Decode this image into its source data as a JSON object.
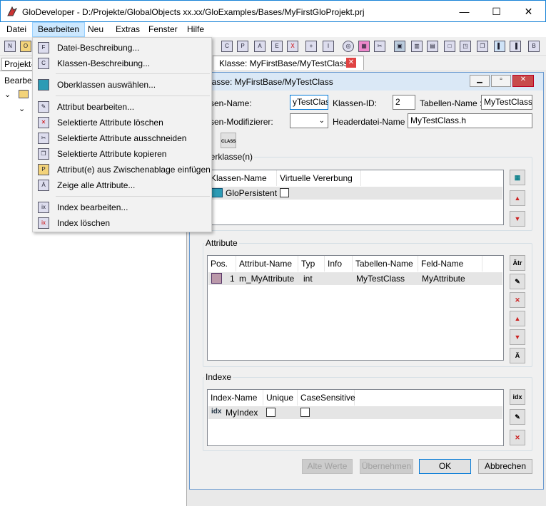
{
  "window": {
    "title": "GloDeveloper - D:/Projekte/GlobalObjects xx.xx/GloExamples/Bases/MyFirstGloProjekt.prj",
    "minimize": "—",
    "maximize": "☐",
    "close": "✕"
  },
  "menubar": [
    "Datei",
    "Bearbeiten",
    "Neu",
    "Extras",
    "Fenster",
    "Hilfe"
  ],
  "left": {
    "tab": "Projekt-",
    "tree_label": "Bearbei"
  },
  "doc_tab": {
    "label": "Klasse: MyFirstBase/MyTestClass",
    "close": "✕"
  },
  "dropdown": [
    {
      "label": "Datei-Beschreibung...",
      "icon": "file-icon"
    },
    {
      "label": "Klassen-Beschreibung...",
      "icon": "class-icon"
    },
    {
      "label": "Oberklassen auswählen...",
      "icon": "superclass-icon"
    },
    {
      "label": "Attribut bearbeiten...",
      "icon": "edit-attribute-icon"
    },
    {
      "label": "Selektierte Attribute löschen",
      "icon": "delete-attribute-icon"
    },
    {
      "label": "Selektierte Attribute ausschneiden",
      "icon": "cut-icon"
    },
    {
      "label": "Selektierte Attribute kopieren",
      "icon": "copy-icon"
    },
    {
      "label": "Attribut(e) aus Zwischenablage einfügen",
      "icon": "paste-icon"
    },
    {
      "label": "Zeige alle Attribute...",
      "icon": "show-attributes-icon"
    },
    {
      "label": "Index bearbeiten...",
      "icon": "edit-index-icon"
    },
    {
      "label": "Index löschen",
      "icon": "delete-index-icon"
    }
  ],
  "child": {
    "title": "Klasse: MyFirstBase/MyTestClass",
    "klassen_name_label": "ssen-Name:",
    "klassen_name_value": "yTestClass",
    "klassen_id_label": "Klassen-ID:",
    "klassen_id_value": "2",
    "tabellen_name_label": "Tabellen-Name :",
    "tabellen_name_value": "MyTestClass",
    "modifier_label": "ssen-Modifizierer:",
    "headerdatei_label": "Headerdatei-Name :",
    "headerdatei_value": "MyTestClass.h",
    "oberklassen": {
      "label": "berklasse(n)",
      "columns": [
        "Klassen-Name",
        "Virtuelle Vererbung"
      ],
      "rows": [
        {
          "name": "GloPersistent"
        }
      ]
    },
    "attribute": {
      "label": "Attribute",
      "columns": [
        "Pos.",
        "Attribut-Name",
        "Typ",
        "Info",
        "Tabellen-Name",
        "Feld-Name"
      ],
      "rows": [
        {
          "pos": "1",
          "name": "m_MyAttribute",
          "typ": "int",
          "info": "",
          "tabelle": "MyTestClass",
          "feld": "MyAttribute"
        }
      ]
    },
    "indexe": {
      "label": "Indexe",
      "columns": [
        "Index-Name",
        "Unique",
        "CaseSensitive"
      ],
      "rows": [
        {
          "name": "MyIndex"
        }
      ]
    },
    "buttons": {
      "alte_werte": "Alte Werte",
      "uebernehmen": "Übernehmen",
      "ok": "OK",
      "abbrechen": "Abbrechen"
    }
  }
}
